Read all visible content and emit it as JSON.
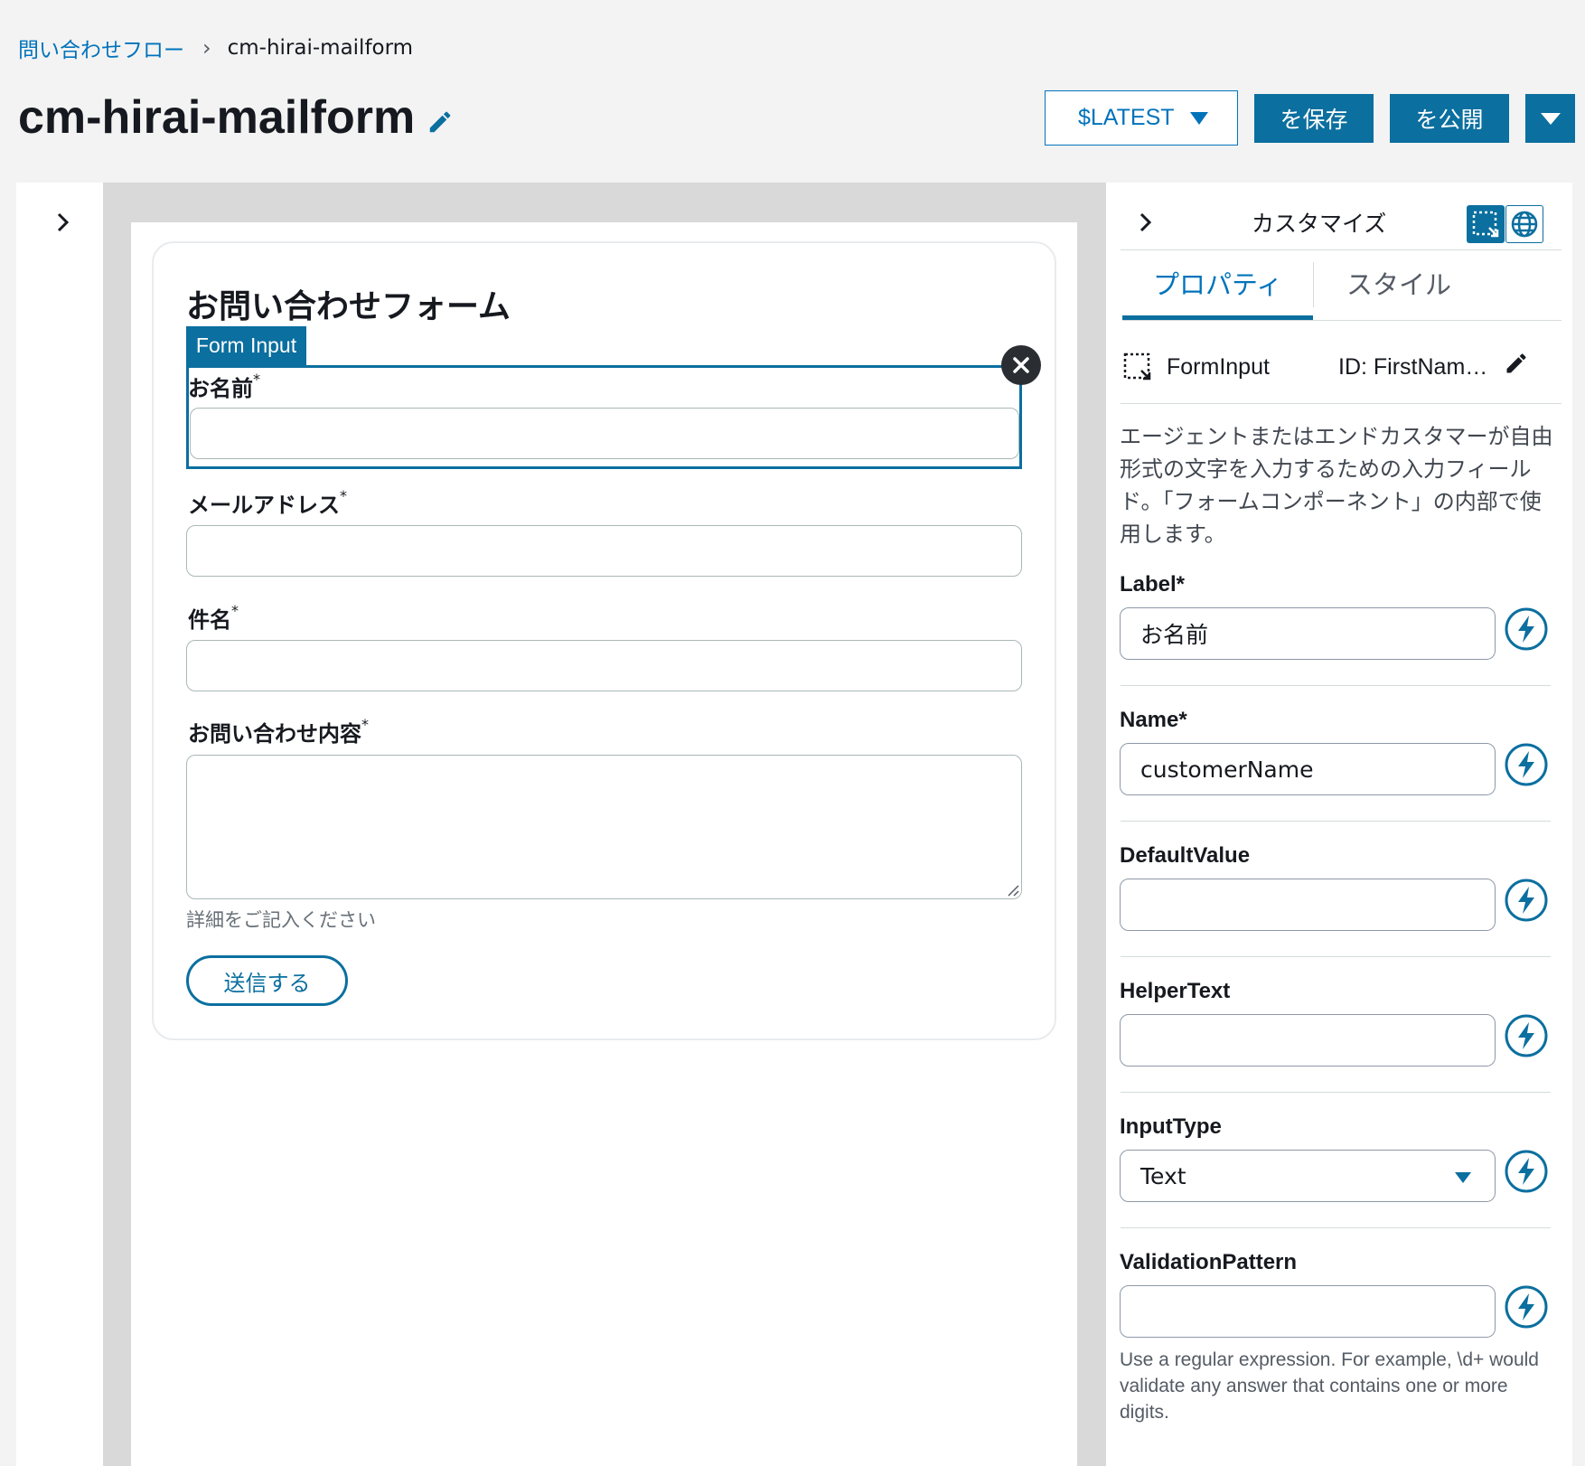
{
  "breadcrumb": {
    "parent": "問い合わせフロー",
    "separator": "›",
    "current": "cm-hirai-mailform"
  },
  "header": {
    "title": "cm-hirai-mailform",
    "version": "$LATEST",
    "save_label": "を保存",
    "publish_label": "を公開"
  },
  "canvas": {
    "form_title": "お問い合わせフォーム",
    "selection_tag": "Form Input",
    "fields": [
      {
        "label": "お名前",
        "required": "*"
      },
      {
        "label": "メールアドレス",
        "required": "*"
      },
      {
        "label": "件名",
        "required": "*"
      },
      {
        "label": "お問い合わせ内容",
        "required": "*"
      }
    ],
    "helper_text": "詳細をご記入ください",
    "submit_label": "送信する"
  },
  "panel": {
    "title": "カスタマイズ",
    "tabs": [
      {
        "label": "プロパティ",
        "active": true
      },
      {
        "label": "スタイル",
        "active": false
      }
    ],
    "component_type": "FormInput",
    "component_id": "ID: FirstName…",
    "description": "エージェントまたはエンドカスタマーが自由形式の文字を入力するための入力フィールド。「フォームコンポーネント」の内部で使用します。",
    "properties": [
      {
        "label": "Label*",
        "value": "お名前"
      },
      {
        "label": "Name*",
        "value": "customerName"
      },
      {
        "label": "DefaultValue",
        "value": ""
      },
      {
        "label": "HelperText",
        "value": ""
      },
      {
        "label": "InputType",
        "value": "Text"
      },
      {
        "label": "ValidationPattern",
        "value": ""
      }
    ],
    "validation_help": "Use a regular expression. For example, \\d+ would validate any answer that contains one or more digits."
  },
  "colors": {
    "accent": "#0b6f9f",
    "link": "#0073bb",
    "canvas_bg": "#d9d9d9",
    "page_bg": "#f3f3f3"
  },
  "icons": [
    "pencil-icon",
    "caret-down-icon",
    "chevron-right-icon",
    "close-icon",
    "selection-icon",
    "globe-icon",
    "bolt-icon",
    "resize-grip-icon"
  ]
}
